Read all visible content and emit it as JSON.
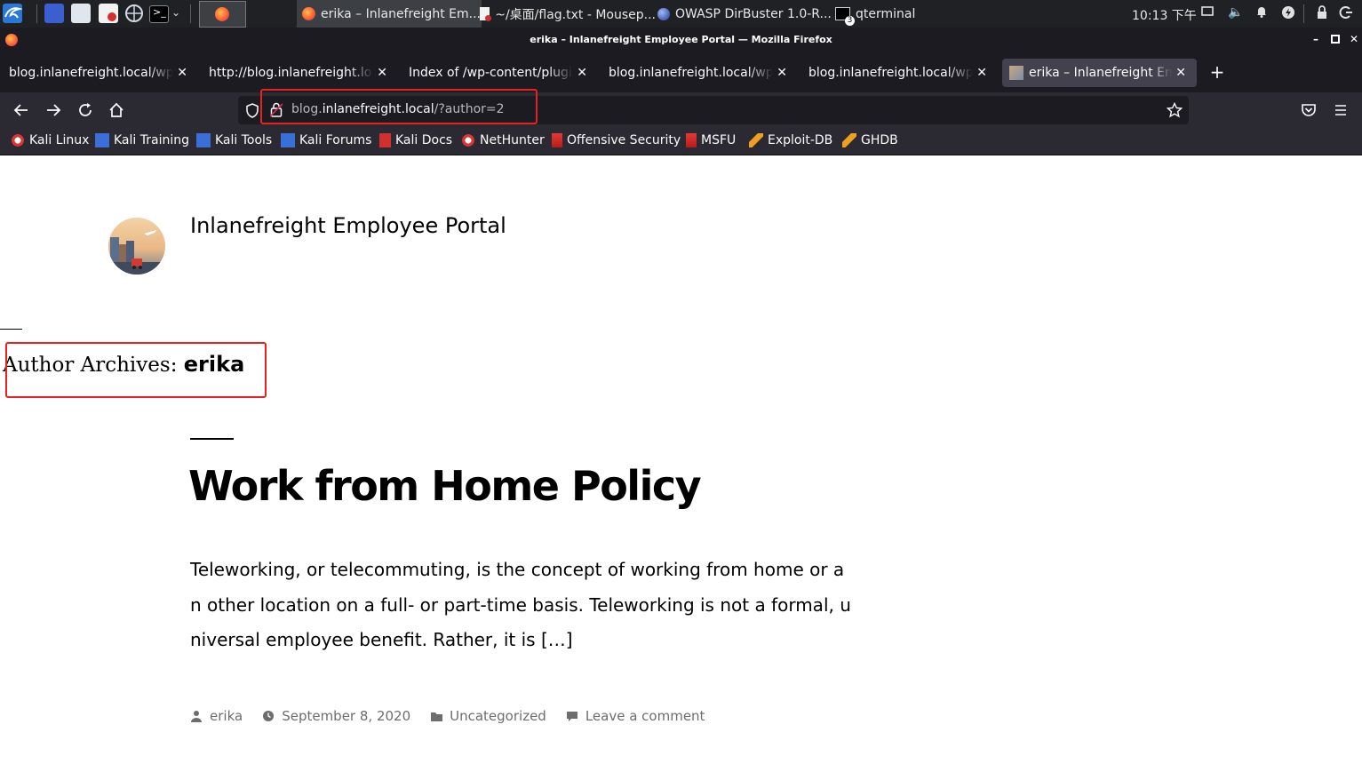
{
  "taskbar": {
    "tasks": [
      {
        "label": "erika – Inlanefreight Em..."
      },
      {
        "label": "~/桌面/flag.txt - Mousep..."
      },
      {
        "label": "OWASP DirBuster 1.0-R..."
      },
      {
        "label": "qterminal"
      }
    ],
    "terminal_badge": "3",
    "clock": "10:13 下午"
  },
  "window": {
    "title": "erika – Inlanefreight Employee Portal — Mozilla Firefox"
  },
  "tabs": [
    {
      "label": "blog.inlanefreight.local/wp-c"
    },
    {
      "label": "http://blog.inlanefreight.local"
    },
    {
      "label": "Index of /wp-content/plugins"
    },
    {
      "label": "blog.inlanefreight.local/wp-c"
    },
    {
      "label": "blog.inlanefreight.local/wp-c"
    },
    {
      "label": "erika – Inlanefreight Empl"
    }
  ],
  "urlbar": {
    "prefix": "blog.",
    "host": "inlanefreight.local",
    "path": "/?author=2"
  },
  "bookmarks": [
    {
      "label": "Kali Linux",
      "icon": "kali-dragon-icon"
    },
    {
      "label": "Kali Training",
      "icon": "kali-training-icon"
    },
    {
      "label": "Kali Tools",
      "icon": "kali-tools-icon"
    },
    {
      "label": "Kali Forums",
      "icon": "kali-forums-icon"
    },
    {
      "label": "Kali Docs",
      "icon": "kali-docs-icon"
    },
    {
      "label": "NetHunter",
      "icon": "nethunter-icon"
    },
    {
      "label": "Offensive Security",
      "icon": "offsec-icon"
    },
    {
      "label": "MSFU",
      "icon": "msfu-icon"
    },
    {
      "label": "Exploit-DB",
      "icon": "exploit-db-icon"
    },
    {
      "label": "GHDB",
      "icon": "ghdb-icon"
    }
  ],
  "page": {
    "site_title": "Inlanefreight Employee Portal",
    "archive_prefix": "Author Archives: ",
    "archive_name": "erika",
    "post_title": "Work from Home Policy",
    "excerpt": "Teleworking, or telecommuting, is the concept of working from home or an other location on a full- or part-time basis. Teleworking is not a formal, universal employee benefit. Rather, it is […]",
    "meta": {
      "author": "erika",
      "date": "September 8, 2020",
      "category": "Uncategorized",
      "comments": "Leave a comment"
    }
  },
  "colors": {
    "annotation_red": "#e6231e",
    "firefox_dark": "#1c1b22",
    "toolbar": "#2b2a33"
  }
}
